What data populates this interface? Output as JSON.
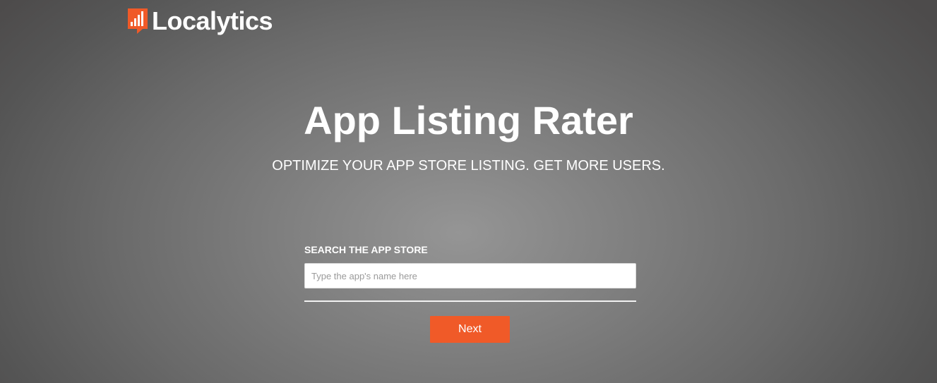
{
  "brand": {
    "name": "Localytics",
    "accent_color": "#f05a28"
  },
  "hero": {
    "title": "App Listing Rater",
    "subtitle": "OPTIMIZE YOUR APP STORE LISTING. GET MORE USERS."
  },
  "search": {
    "label": "SEARCH THE APP STORE",
    "placeholder": "Type the app's name here",
    "value": ""
  },
  "actions": {
    "next_label": "Next"
  }
}
